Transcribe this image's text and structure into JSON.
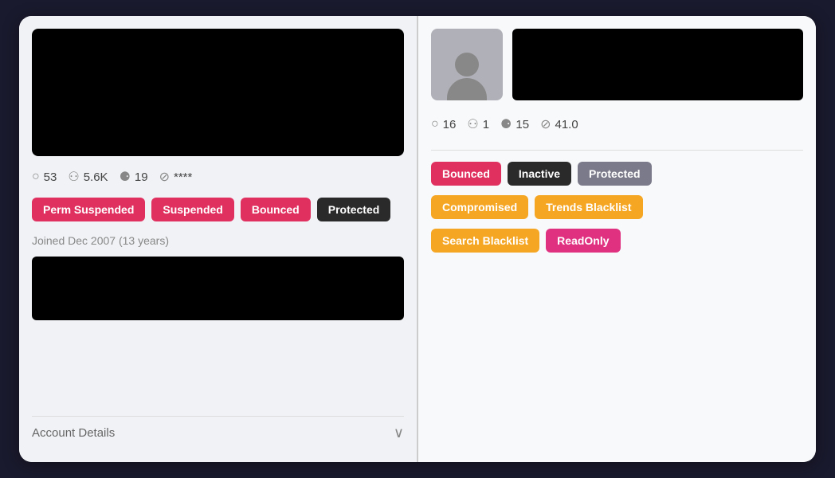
{
  "left": {
    "stats": {
      "comments": "53",
      "followers": "5.6K",
      "following": "19",
      "score": "****"
    },
    "tags": [
      {
        "label": "Perm Suspended",
        "style": "tag-red"
      },
      {
        "label": "Suspended",
        "style": "tag-red"
      },
      {
        "label": "Bounced",
        "style": "tag-red"
      },
      {
        "label": "Protected",
        "style": "tag-dark"
      }
    ],
    "joined": "Joined Dec 2007 (13 years)",
    "account_details": "Account Details"
  },
  "right": {
    "stats": {
      "comments": "16",
      "followers": "1",
      "following": "15",
      "score": "41.0"
    },
    "tags_row1": [
      {
        "label": "Bounced",
        "style": "tag-red"
      },
      {
        "label": "Inactive",
        "style": "tag-dark"
      },
      {
        "label": "Protected",
        "style": "tag-gray"
      }
    ],
    "tags_row2": [
      {
        "label": "Compromised",
        "style": "tag-orange"
      },
      {
        "label": "Trends Blacklist",
        "style": "tag-orange"
      }
    ],
    "tags_row3": [
      {
        "label": "Search Blacklist",
        "style": "tag-orange"
      },
      {
        "label": "ReadOnly",
        "style": "tag-pink"
      }
    ]
  },
  "icons": {
    "comment": "○",
    "followers": "⚇",
    "following": "⚈",
    "block": "⊘",
    "chevron_down": "∨"
  }
}
